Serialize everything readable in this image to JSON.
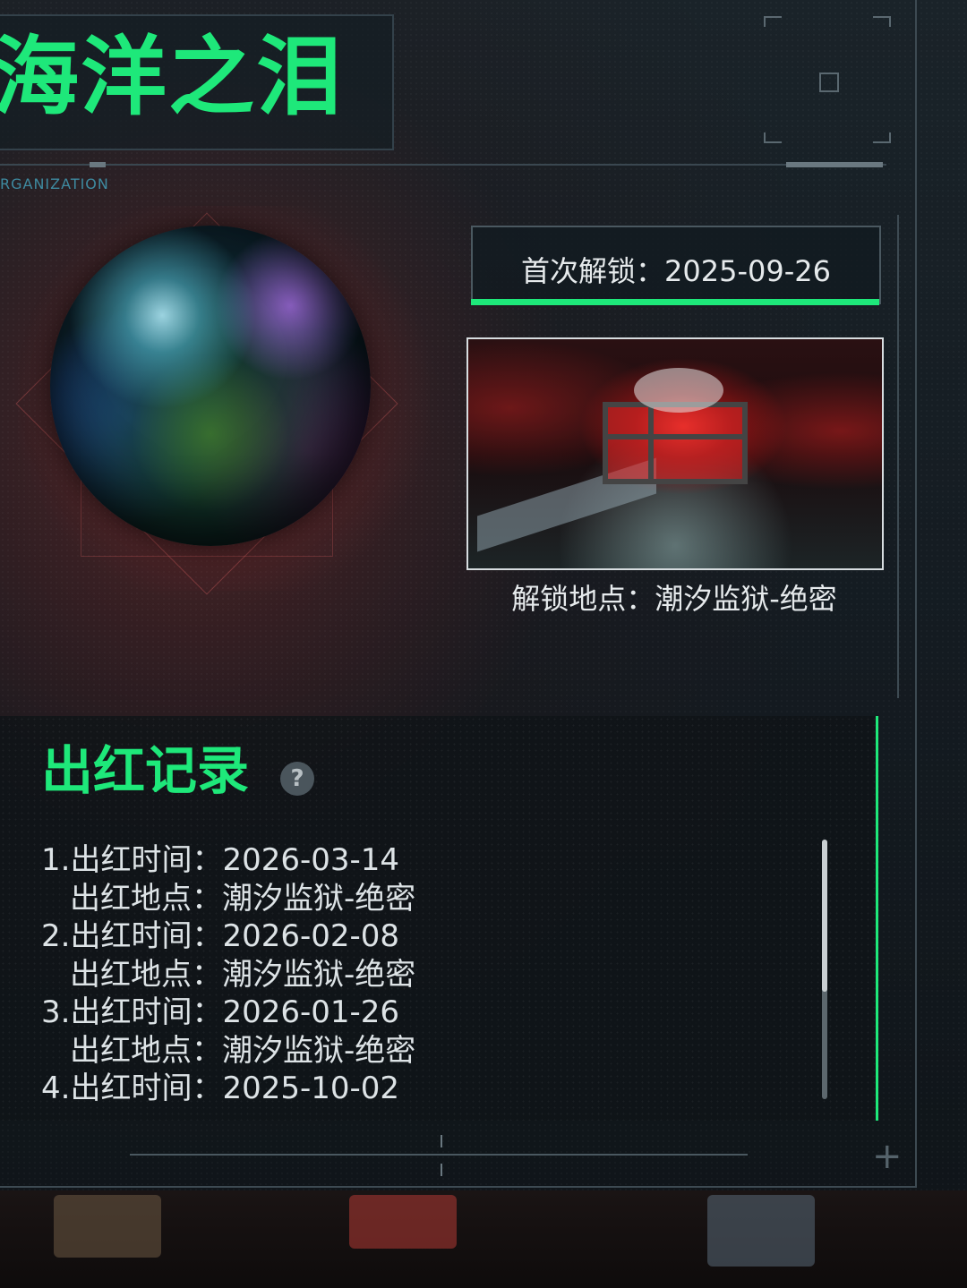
{
  "item": {
    "name": "海洋之泪",
    "org_label": "RGANIZATION",
    "first_unlock": "首次解锁：2025-09-26",
    "unlock_location": "解锁地点：潮汐监狱-绝密"
  },
  "records": {
    "title": "出红记录",
    "help_icon": "?",
    "lines": [
      {
        "text": "1.出红时间：2026-03-14",
        "indent": false
      },
      {
        "text": "出红地点：潮汐监狱-绝密",
        "indent": true
      },
      {
        "text": "2.出红时间：2026-02-08",
        "indent": false
      },
      {
        "text": "出红地点：潮汐监狱-绝密",
        "indent": true
      },
      {
        "text": "3.出红时间：2026-01-26",
        "indent": false
      },
      {
        "text": "出红地点：潮汐监狱-绝密",
        "indent": true
      },
      {
        "text": "4.出红时间：2025-10-02",
        "indent": false
      }
    ]
  },
  "colors": {
    "accent": "#1ee87a",
    "text": "#e6eaec",
    "panel_border": "#3d4a52"
  },
  "icons": [
    "help-icon",
    "plus-icon"
  ]
}
